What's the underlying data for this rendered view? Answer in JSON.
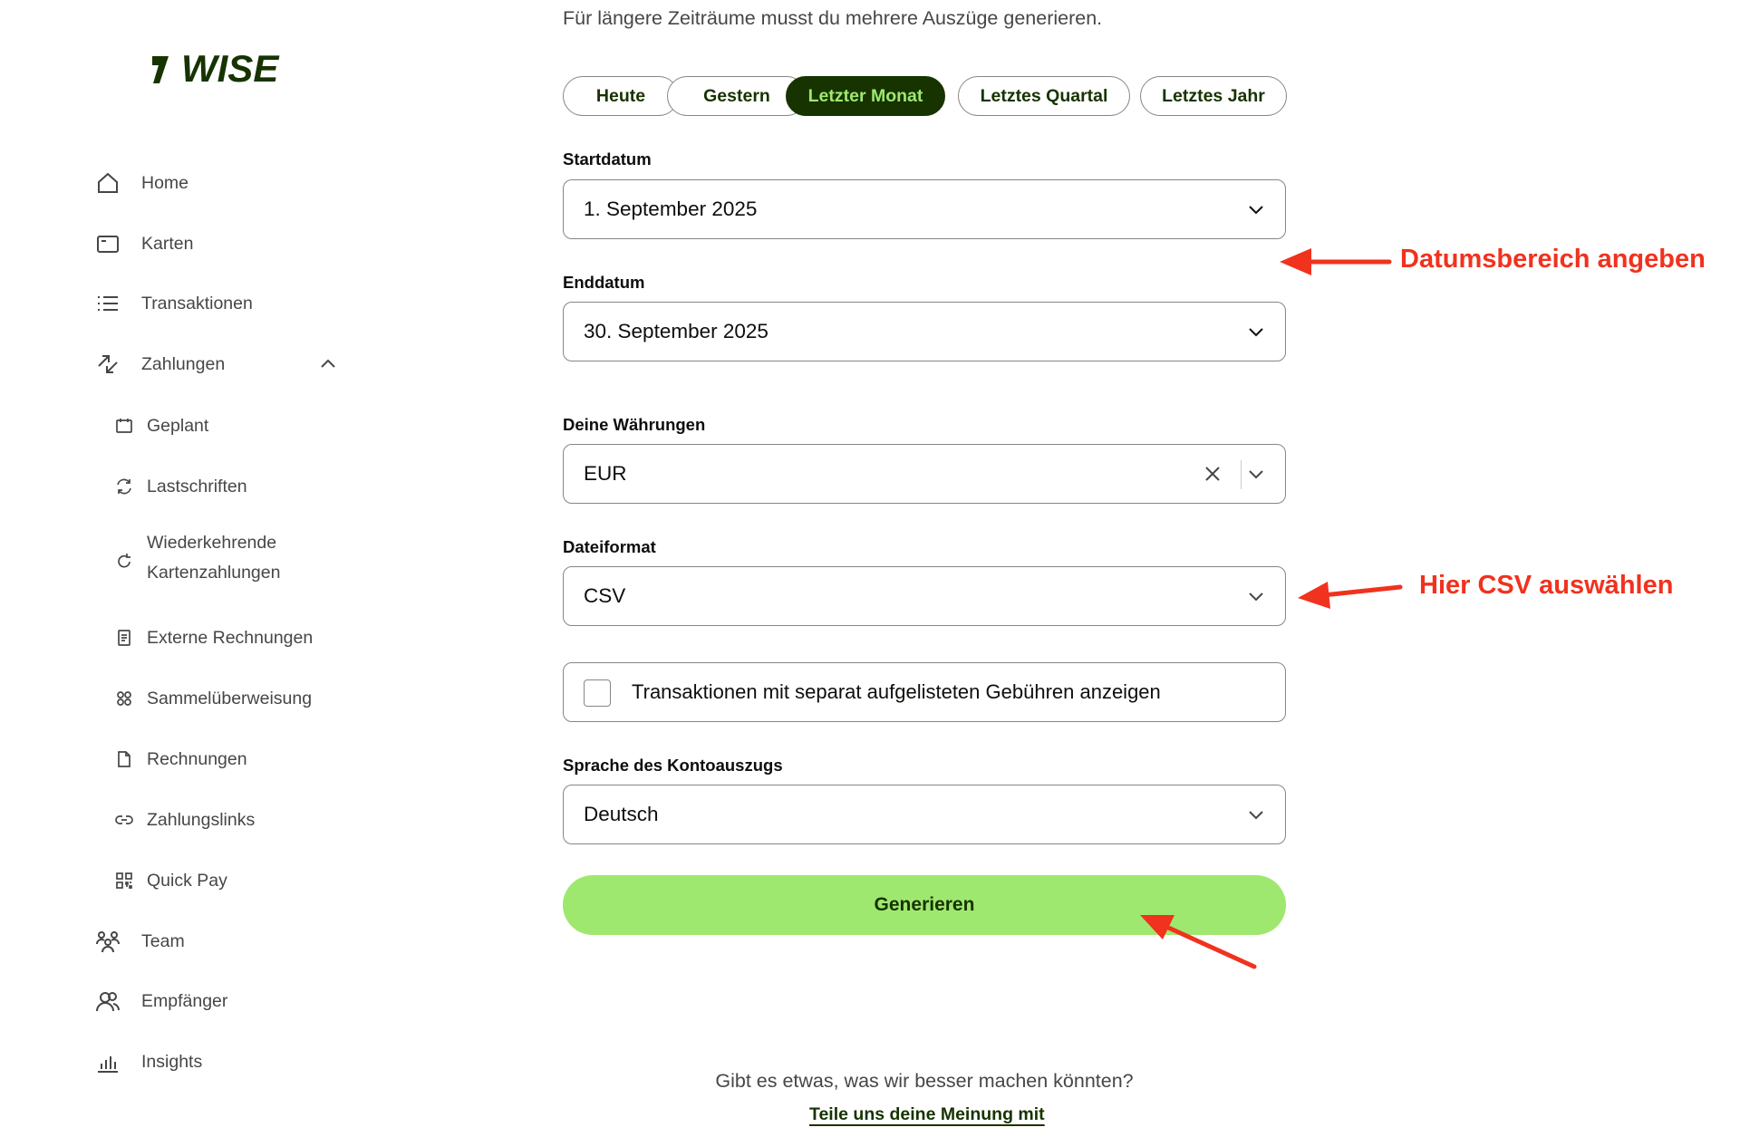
{
  "brand": {
    "logo_text": "WISE",
    "color": "#163300",
    "accent": "#9fe870"
  },
  "sidebar": {
    "items": [
      {
        "label": "Home",
        "icon": "home-icon"
      },
      {
        "label": "Karten",
        "icon": "card-icon"
      },
      {
        "label": "Transaktionen",
        "icon": "list-icon"
      },
      {
        "label": "Zahlungen",
        "icon": "payments-icon",
        "expanded": true
      },
      {
        "label": "Team",
        "icon": "team-icon"
      },
      {
        "label": "Empfänger",
        "icon": "recipients-icon"
      },
      {
        "label": "Insights",
        "icon": "insights-icon"
      }
    ],
    "subitems": [
      {
        "label": "Geplant",
        "icon": "calendar-icon"
      },
      {
        "label": "Lastschriften",
        "icon": "refresh-icon"
      },
      {
        "label": "Wiederkehrende",
        "label2": "Kartenzahlungen",
        "icon": "recurring-icon"
      },
      {
        "label": "Externe Rechnungen",
        "icon": "receipt-icon"
      },
      {
        "label": "Sammelüberweisung",
        "icon": "batch-icon"
      },
      {
        "label": "Rechnungen",
        "icon": "document-icon"
      },
      {
        "label": "Zahlungslinks",
        "icon": "link-icon"
      },
      {
        "label": "Quick Pay",
        "icon": "qr-icon"
      }
    ]
  },
  "main": {
    "intro": "Für längere Zeiträume musst du mehrere Auszüge generieren.",
    "presets": [
      "Heute",
      "Gestern",
      "Letzter Monat",
      "Letztes Quartal",
      "Letztes Jahr"
    ],
    "active_preset": "Letzter Monat",
    "start_date": {
      "label": "Startdatum",
      "value": "1. September 2025"
    },
    "end_date": {
      "label": "Enddatum",
      "value": "30. September 2025"
    },
    "currencies": {
      "label": "Deine Währungen",
      "value": "EUR"
    },
    "file_format": {
      "label": "Dateiformat",
      "value": "CSV"
    },
    "fees_checkbox": {
      "label": "Transaktionen mit separat aufgelisteten Gebühren anzeigen",
      "checked": false
    },
    "language": {
      "label": "Sprache des Kontoauszugs",
      "value": "Deutsch"
    },
    "generate_label": "Generieren",
    "feedback_question": "Gibt es etwas, was wir besser machen könnten?",
    "feedback_link": "Teile uns deine Meinung mit"
  },
  "annotations": {
    "date_range": "Datumsbereich angeben",
    "csv": "Hier CSV auswählen",
    "color": "#f0321e"
  }
}
